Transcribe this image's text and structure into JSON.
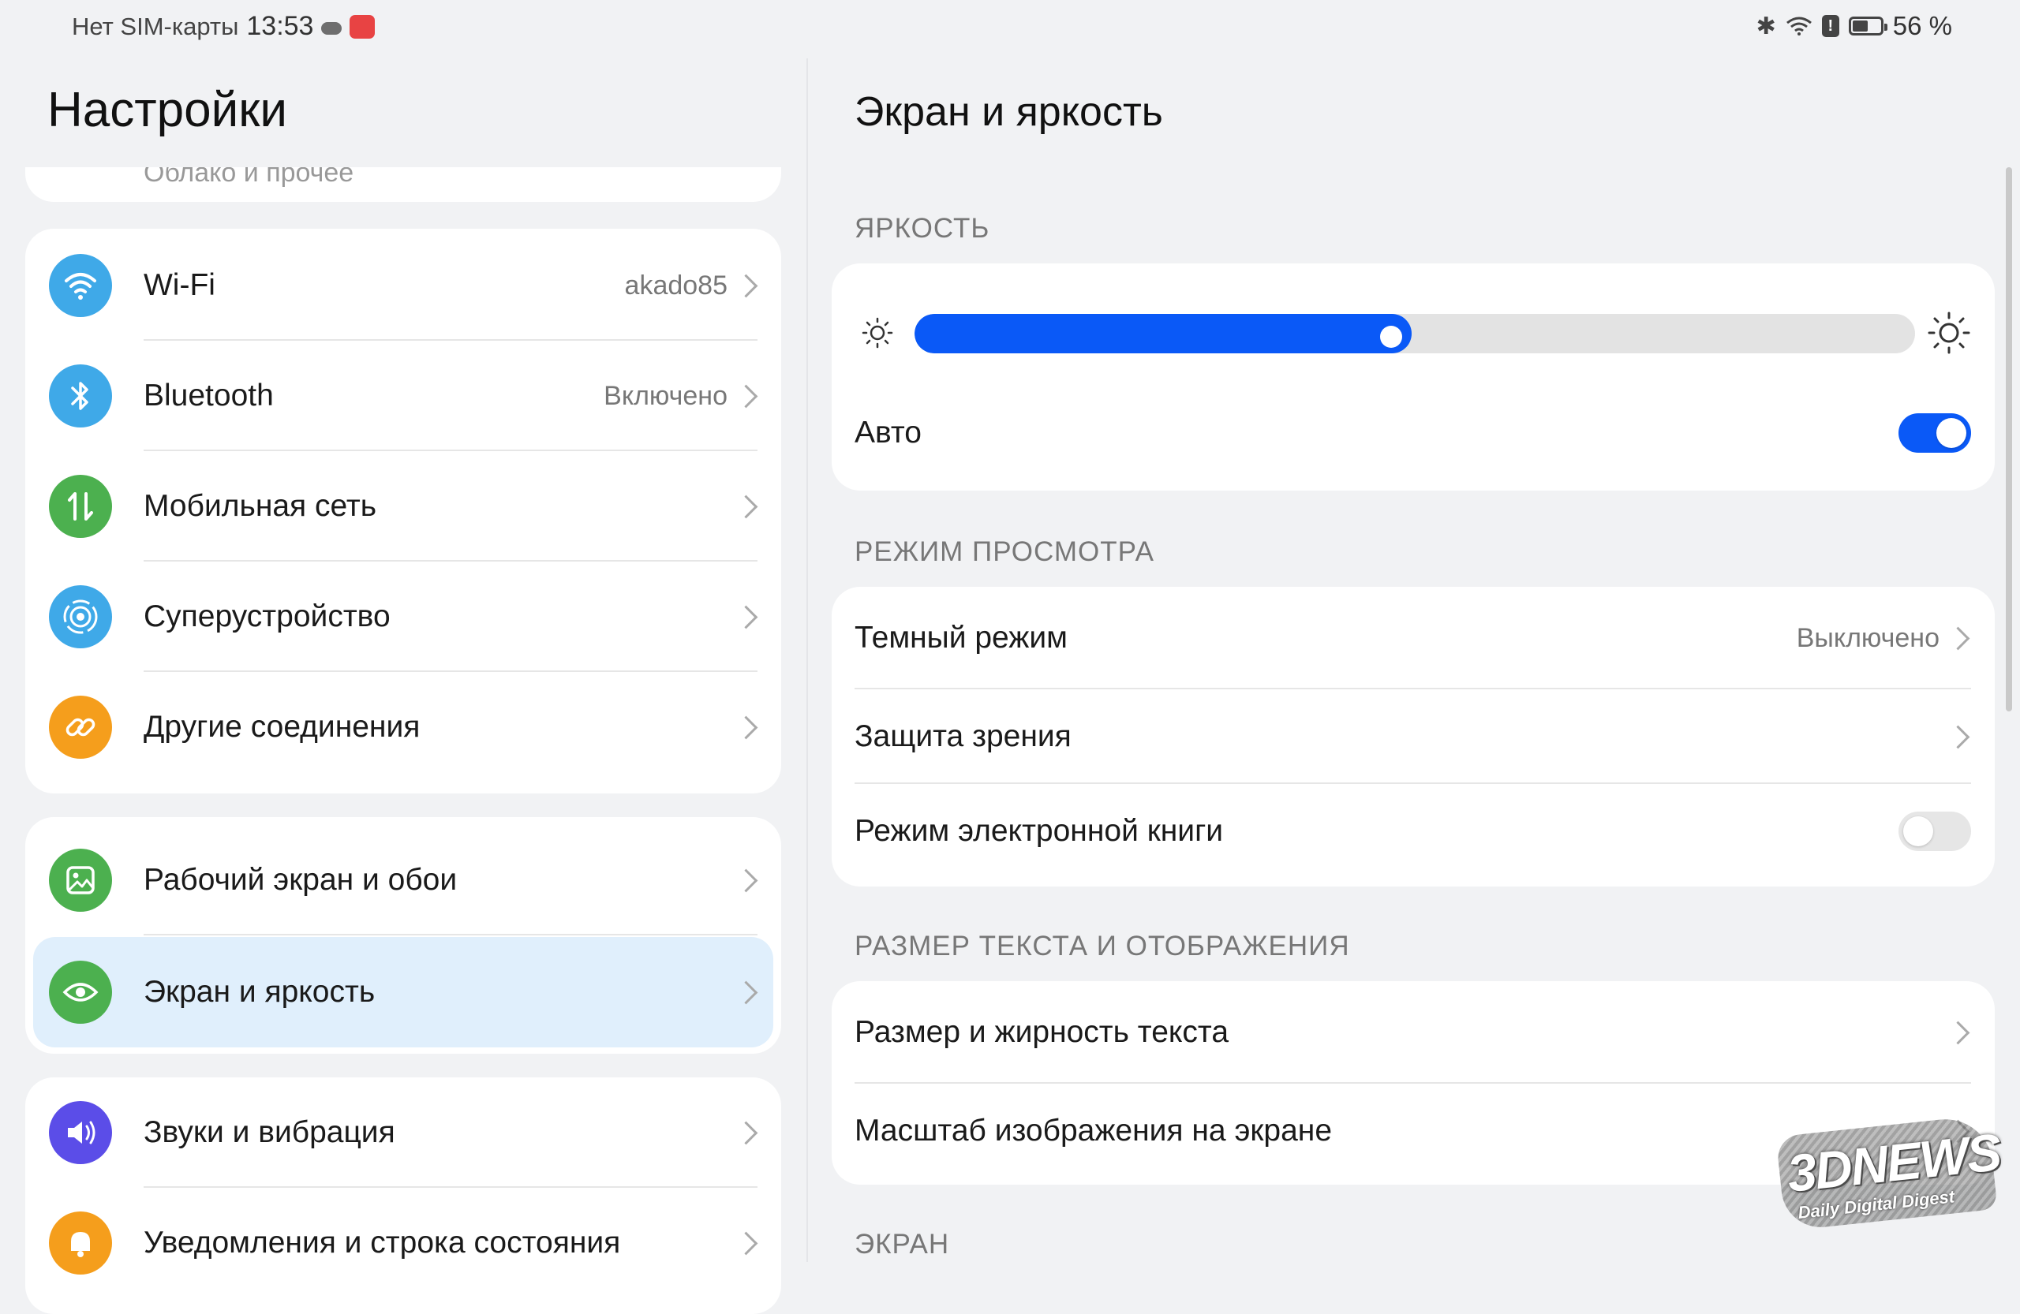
{
  "status_bar": {
    "carrier": "Нет SIM-карты",
    "time": "13:53",
    "battery_percent_text": "56 %",
    "battery_level": 0.56
  },
  "left": {
    "title": "Настройки",
    "partial_item": "Облако и прочее",
    "group1": [
      {
        "label": "Wi-Fi",
        "value": "akado85",
        "icon": "wifi-icon",
        "color": "#3fa9e8"
      },
      {
        "label": "Bluetooth",
        "value": "Включено",
        "icon": "bluetooth-icon",
        "color": "#3fa9e8"
      },
      {
        "label": "Мобильная сеть",
        "value": "",
        "icon": "mobile-data-icon",
        "color": "#4cb04f"
      },
      {
        "label": "Суперустройство",
        "value": "",
        "icon": "super-device-icon",
        "color": "#3fa9e8"
      },
      {
        "label": "Другие соединения",
        "value": "",
        "icon": "link-icon",
        "color": "#f59e1c"
      }
    ],
    "group2": [
      {
        "label": "Рабочий экран и обои",
        "icon": "wallpaper-icon",
        "color": "#4cb04f"
      },
      {
        "label": "Экран и яркость",
        "icon": "eye-icon",
        "color": "#4cb04f",
        "selected": true
      }
    ],
    "group3": [
      {
        "label": "Звуки и вибрация",
        "icon": "sound-icon",
        "color": "#5b4de8"
      },
      {
        "label": "Уведомления и строка состояния",
        "icon": "bell-icon",
        "color": "#f59e1c"
      }
    ]
  },
  "right": {
    "title": "Экран и яркость",
    "brightness_header": "ЯРКОСТЬ",
    "brightness_level": 0.497,
    "auto_label": "Авто",
    "auto_on": true,
    "view_mode_header": "РЕЖИМ ПРОСМОТРА",
    "dark_mode_label": "Темный режим",
    "dark_mode_value": "Выключено",
    "eye_comfort_label": "Защита зрения",
    "ebook_label": "Режим электронной книги",
    "ebook_on": false,
    "text_size_header": "РАЗМЕР ТЕКСТА И ОТОБРАЖЕНИЯ",
    "text_size_label": "Размер и жирность текста",
    "display_scale_label": "Масштаб изображения на экране",
    "screen_header": "ЭКРАН"
  },
  "watermark": {
    "brand": "3DNEWS",
    "tagline": "Daily Digital Digest"
  },
  "colors": {
    "accent": "#0a59f7",
    "selected_bg": "#e0effc",
    "page_bg": "#f1f2f4"
  }
}
